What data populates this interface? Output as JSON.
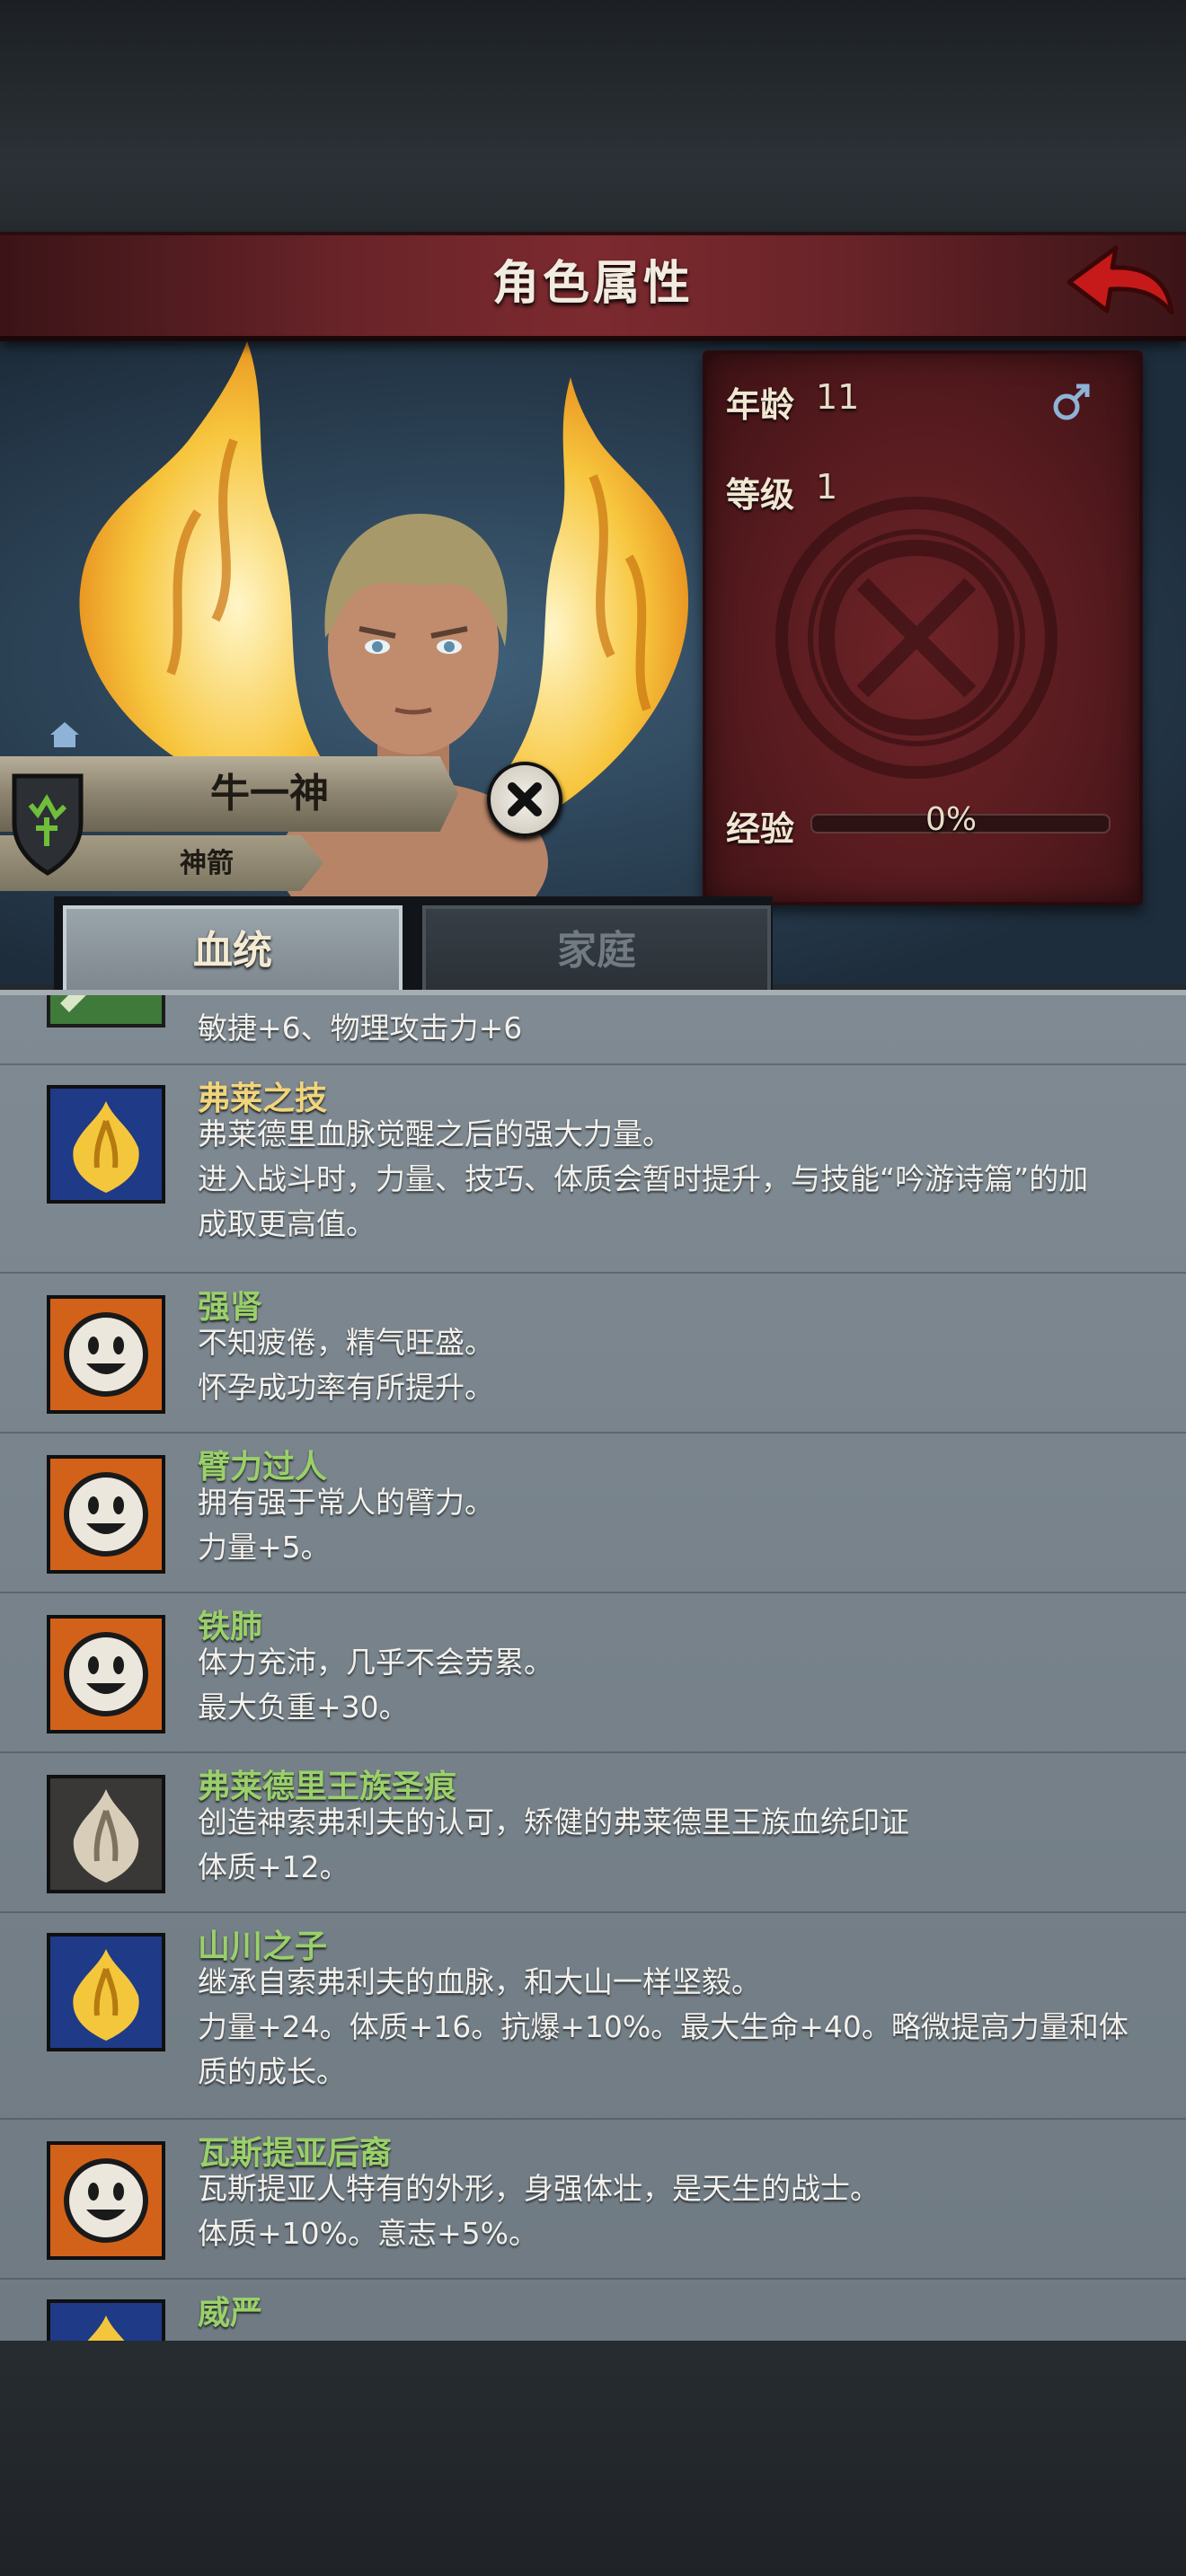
{
  "header": {
    "title": "角色属性",
    "back_icon": "back-arrow-icon"
  },
  "character": {
    "name": "牛一神",
    "title": "神箭",
    "gender_icon": "male-symbol-icon"
  },
  "stats": {
    "age_label": "年龄",
    "age_value": "11",
    "level_label": "等级",
    "level_value": "1",
    "exp_label": "经验",
    "exp_value": "0%",
    "exp_progress": 0
  },
  "tabs": [
    {
      "label": "血统",
      "active": true
    },
    {
      "label": "家庭",
      "active": false
    }
  ],
  "traits": [
    {
      "title": "",
      "desc": [
        "敏捷+6、物理攻击力+6"
      ],
      "icon": "partial-green-icon"
    },
    {
      "title": "弗莱之技",
      "title_color": "gold",
      "desc": [
        "弗莱德里血脉觉醒之后的强大力量。",
        "进入战斗时，力量、技巧、体质会暂时提升，与技能“吟游诗篇”的加",
        "成取更高值。"
      ],
      "icon": "golden-wings-icon"
    },
    {
      "title": "强肾",
      "desc": [
        "不知疲倦，精气旺盛。",
        "怀孕成功率有所提升。"
      ],
      "icon": "smiley-face-icon"
    },
    {
      "title": "臂力过人",
      "desc": [
        "拥有强于常人的臂力。",
        "力量+5。"
      ],
      "icon": "smiley-face-icon"
    },
    {
      "title": "铁肺",
      "desc": [
        "体力充沛，几乎不会劳累。",
        "最大负重+30。"
      ],
      "icon": "smiley-face-icon"
    },
    {
      "title": "弗莱德里王族圣痕",
      "desc": [
        "创造神索弗利夫的认可，矫健的弗莱德里王族血统印证",
        "体质+12。"
      ],
      "icon": "silver-wings-icon"
    },
    {
      "title": "山川之子",
      "desc": [
        "继承自索弗利夫的血脉，和大山一样坚毅。",
        "力量+24。体质+16。抗爆+10%。最大生命+40。略微提高力量和体",
        "质的成长。"
      ],
      "icon": "golden-wings-icon"
    },
    {
      "title": "瓦斯提亚后裔",
      "desc": [
        "瓦斯提亚人特有的外形，身强体壮，是天生的战士。",
        "体质+10%。意志+5%。"
      ],
      "icon": "smiley-face-icon"
    },
    {
      "title": "威严",
      "desc": [],
      "icon": "golden-wings-icon"
    }
  ],
  "colors": {
    "header": "#6a2429",
    "trait_title": "#9ad06a",
    "trait_title_gold": "#f1d57a",
    "panel": "#78838b"
  }
}
